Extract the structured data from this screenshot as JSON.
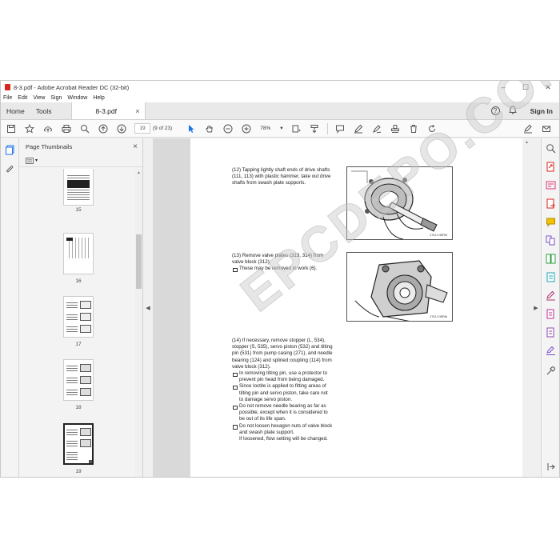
{
  "window": {
    "title": "8-3.pdf - Adobe Acrobat Reader DC (32-bit)",
    "min": "–",
    "max": "☐",
    "close": "✕"
  },
  "menu": [
    "File",
    "Edit",
    "View",
    "Sign",
    "Window",
    "Help"
  ],
  "tabs": {
    "home": "Home",
    "tools": "Tools",
    "file": "8-3.pdf",
    "close": "×"
  },
  "header_right": {
    "help": "?",
    "signin": "Sign In"
  },
  "toolbar": {
    "page_current": "19",
    "page_of": "(9 of 23)",
    "zoom": "78%"
  },
  "thumbnails": {
    "title": "Page Thumbnails",
    "close": "×",
    "pages": [
      "15",
      "16",
      "17",
      "18",
      "19"
    ]
  },
  "watermark": "EPCDEPO.COM",
  "document": {
    "step12": "(12) Tapping lightly shaft ends of drive shafts (111, 113) with plastic hammer, take out drive shafts from swash plate supports.",
    "step13": "(13) Remove valve plates (313, 314) from valve block (312).",
    "step13_note": "These may be removed in work (6).",
    "step14": "(14) If necessary, remove stopper (L, 534), stopper (S, 535), servo piston (532) and tilting pin (531) from pump casing (271), and needle bearing (124) and splined coupling (114) from valve block (312).",
    "step14_notes": [
      "In removing tilting pin, use a protector to prevent pin head from being damaged.",
      "Since loctite is applied to fitting areas of tilting pin and servo piston, take care not to damage servo piston.",
      "Do not remove needle bearing as far as possible, except when it is considered to be out of its life span.",
      "Do not loosen hexagon nuts of valve block and swash plate support.\nIf loosened, flow setting will be changed."
    ],
    "fig1_caption": "2702-0 98Fit5",
    "fig2_caption": "2702-0 98Fit6"
  }
}
